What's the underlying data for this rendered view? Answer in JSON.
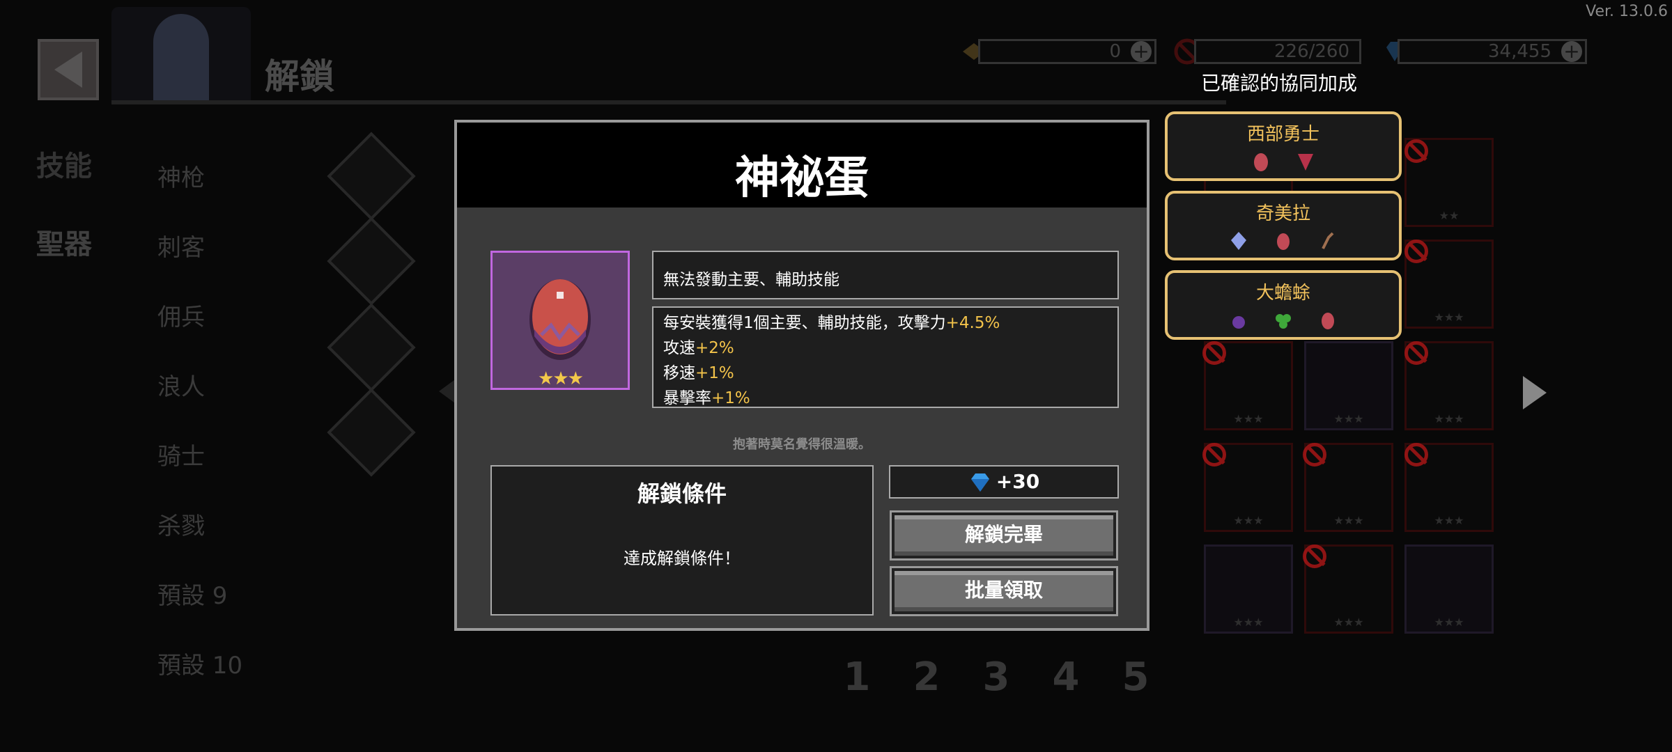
{
  "version": "Ver. 13.0.6",
  "header": {
    "title": "解鎖"
  },
  "resources": {
    "ticket": "0",
    "slots": "226/260",
    "gems": "34,455"
  },
  "bonus_title": "已確認的協同加成",
  "nav": {
    "skill": "技能",
    "relic": "聖器",
    "presets": [
      "神枪",
      "刺客",
      "佣兵",
      "浪人",
      "骑士",
      "杀戮",
      "預設 9",
      "預設 10"
    ]
  },
  "pages": [
    "1",
    "2",
    "3",
    "4",
    "5"
  ],
  "synergies": [
    {
      "name": "西部勇士"
    },
    {
      "name": "奇美拉"
    },
    {
      "name": "大蟾蜍"
    }
  ],
  "modal": {
    "title": "神祕蛋",
    "item_stars": "★★★",
    "description": "無法發動主要、輔助技能",
    "stats": [
      {
        "label": "每安裝獲得1個主要、輔助技能，攻擊力",
        "value": "+4.5%"
      },
      {
        "label": "攻速",
        "value": "+2%"
      },
      {
        "label": "移速",
        "value": "+1%"
      },
      {
        "label": "暴擊率",
        "value": "+1%"
      }
    ],
    "flavor": "抱著時莫名覺得很溫暖。",
    "condition_title": "解鎖條件",
    "condition_text": "達成解鎖條件！",
    "reward": "+30",
    "unlock_done_label": "解鎖完畢",
    "batch_claim_label": "批量領取"
  },
  "colors": {
    "highlight": "#f3c34a",
    "synergy_border": "#e6c173",
    "item_frame": "#c167e0"
  }
}
